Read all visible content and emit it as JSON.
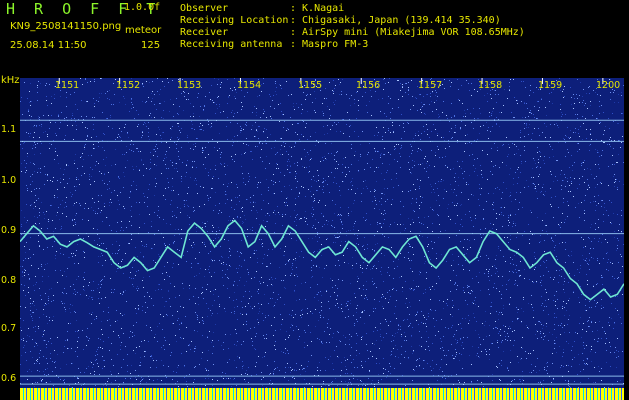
{
  "header": {
    "app_title": "H R O F F T",
    "version": "1.0.0f",
    "filename": "KN9_2508141150.png",
    "mode": "meteor",
    "datetime": "25.08.14 11:50",
    "count": "125",
    "info": [
      {
        "key": "Observer",
        "value": ": K.Nagai"
      },
      {
        "key": "Receiving Location",
        "value": ": Chigasaki, Japan (139.414 35.340)"
      },
      {
        "key": "Receiver",
        "value": ": AirSpy mini (Miakejima VOR 108.65MHz)"
      },
      {
        "key": "Receiving antenna",
        "value": ": Maspro FM-3"
      }
    ]
  },
  "spectrogram": {
    "y_unit": "kHz",
    "x_tick_labels": [
      "1151",
      "1152",
      "1153",
      "1154",
      "1155",
      "1156",
      "1157",
      "1158",
      "1159",
      "1200"
    ],
    "y_tick_labels": [
      "1.1",
      "1.0",
      "0.9",
      "0.8",
      "0.7",
      "0.6"
    ],
    "y_ticks": [
      1.1,
      1.0,
      0.9,
      0.8,
      0.7,
      0.6
    ],
    "y_range": [
      0.585,
      1.18
    ],
    "reference_lines_khz": [
      1.1,
      1.06,
      0.885,
      0.615,
      0.6
    ],
    "colors": {
      "background": "#0d1f7a",
      "trace": "#6ee6d2",
      "line": "#9fd6ff",
      "label": "#e6e600",
      "title": "#8cf52a"
    },
    "trace_khz": [
      0.87,
      0.885,
      0.9,
      0.89,
      0.875,
      0.88,
      0.865,
      0.86,
      0.87,
      0.875,
      0.868,
      0.86,
      0.855,
      0.85,
      0.83,
      0.82,
      0.825,
      0.84,
      0.83,
      0.815,
      0.82,
      0.84,
      0.86,
      0.85,
      0.84,
      0.89,
      0.905,
      0.895,
      0.88,
      0.86,
      0.875,
      0.9,
      0.91,
      0.895,
      0.86,
      0.87,
      0.9,
      0.885,
      0.86,
      0.875,
      0.9,
      0.89,
      0.87,
      0.85,
      0.84,
      0.855,
      0.86,
      0.845,
      0.85,
      0.87,
      0.86,
      0.84,
      0.83,
      0.845,
      0.86,
      0.855,
      0.84,
      0.86,
      0.875,
      0.88,
      0.86,
      0.83,
      0.82,
      0.835,
      0.855,
      0.86,
      0.845,
      0.83,
      0.84,
      0.87,
      0.89,
      0.885,
      0.87,
      0.855,
      0.85,
      0.84,
      0.82,
      0.83,
      0.845,
      0.85,
      0.83,
      0.82,
      0.8,
      0.79,
      0.77,
      0.76,
      0.77,
      0.78,
      0.765,
      0.77,
      0.79
    ]
  }
}
